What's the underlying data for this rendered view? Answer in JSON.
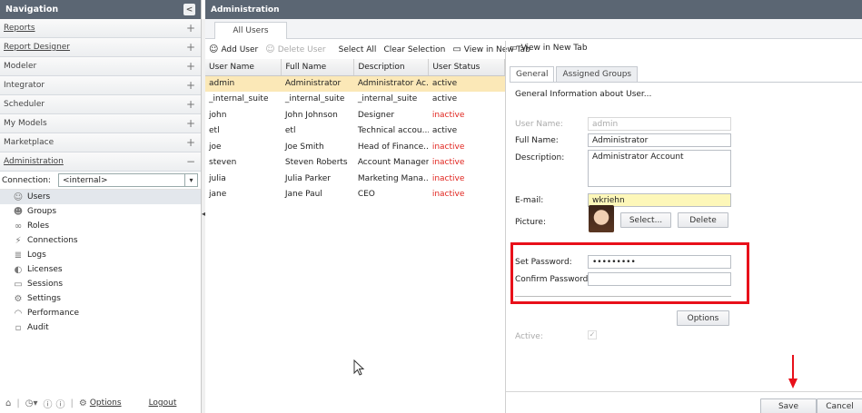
{
  "nav": {
    "title": "Navigation",
    "collapse_glyph": "<",
    "sections": [
      {
        "label": "Reports",
        "toggle": "+"
      },
      {
        "label": "Report Designer",
        "toggle": "+"
      },
      {
        "label": "Modeler",
        "toggle": "+"
      },
      {
        "label": "Integrator",
        "toggle": "+"
      },
      {
        "label": "Scheduler",
        "toggle": "+"
      },
      {
        "label": "My Models",
        "toggle": "+"
      },
      {
        "label": "Marketplace",
        "toggle": "+"
      },
      {
        "label": "Administration",
        "toggle": "−"
      }
    ],
    "connection_label": "Connection:",
    "connection_value": "<internal>",
    "admin_items": [
      {
        "label": "Users",
        "icon": "users-icon"
      },
      {
        "label": "Groups",
        "icon": "groups-icon"
      },
      {
        "label": "Roles",
        "icon": "roles-icon"
      },
      {
        "label": "Connections",
        "icon": "connections-icon"
      },
      {
        "label": "Logs",
        "icon": "logs-icon"
      },
      {
        "label": "Licenses",
        "icon": "licenses-icon"
      },
      {
        "label": "Sessions",
        "icon": "sessions-icon"
      },
      {
        "label": "Settings",
        "icon": "settings-icon"
      },
      {
        "label": "Performance",
        "icon": "performance-icon"
      },
      {
        "label": "Audit",
        "icon": "audit-icon"
      }
    ],
    "footer": {
      "options": "Options",
      "logout": "Logout"
    }
  },
  "admin": {
    "title": "Administration",
    "tab": "All Users",
    "toolbar": {
      "add_user": "Add User",
      "delete_user": "Delete User",
      "select_all": "Select All",
      "clear_selection": "Clear Selection",
      "view_new_tab": "View in New Tab"
    },
    "columns": [
      "User Name",
      "Full Name",
      "Description",
      "User Status"
    ],
    "rows": [
      {
        "user": "admin",
        "full": "Administrator",
        "desc": "Administrator Ac...",
        "status": "active"
      },
      {
        "user": "_internal_suite",
        "full": "_internal_suite",
        "desc": "_internal_suite",
        "status": "active"
      },
      {
        "user": "john",
        "full": "John Johnson",
        "desc": "Designer",
        "status": "inactive"
      },
      {
        "user": "etl",
        "full": "etl",
        "desc": "Technical accou...",
        "status": "active"
      },
      {
        "user": "joe",
        "full": "Joe Smith",
        "desc": "Head of Finance...",
        "status": "inactive"
      },
      {
        "user": "steven",
        "full": "Steven Roberts",
        "desc": "Account Manager",
        "status": "inactive"
      },
      {
        "user": "julia",
        "full": "Julia Parker",
        "desc": "Marketing Mana...",
        "status": "inactive"
      },
      {
        "user": "jane",
        "full": "Jane Paul",
        "desc": "CEO",
        "status": "inactive"
      }
    ]
  },
  "detail": {
    "view_new_tab": "View in New Tab",
    "tabs": [
      "General",
      "Assigned Groups"
    ],
    "section_title": "General Information about User...",
    "fields": {
      "user_name_label": "User Name:",
      "user_name_value": "admin",
      "full_name_label": "Full Name:",
      "full_name_value": "Administrator",
      "description_label": "Description:",
      "description_value": "Administrator Account",
      "email_label": "E-mail:",
      "email_value": "wkriehn",
      "picture_label": "Picture:",
      "select_btn": "Select...",
      "delete_btn": "Delete",
      "set_password_label": "Set Password:",
      "set_password_value": "•••••••••",
      "confirm_password_label": "Confirm Password:",
      "confirm_password_value": "",
      "options_btn": "Options",
      "active_label": "Active:",
      "active_check": "✓"
    },
    "save_btn": "Save",
    "cancel_btn": "Cancel"
  },
  "colors": {
    "header": "#5b6673",
    "selection": "#fbe8b7",
    "inactive": "#e0231d",
    "highlight": "#e8101a",
    "email_bg": "#fdf7b9"
  }
}
